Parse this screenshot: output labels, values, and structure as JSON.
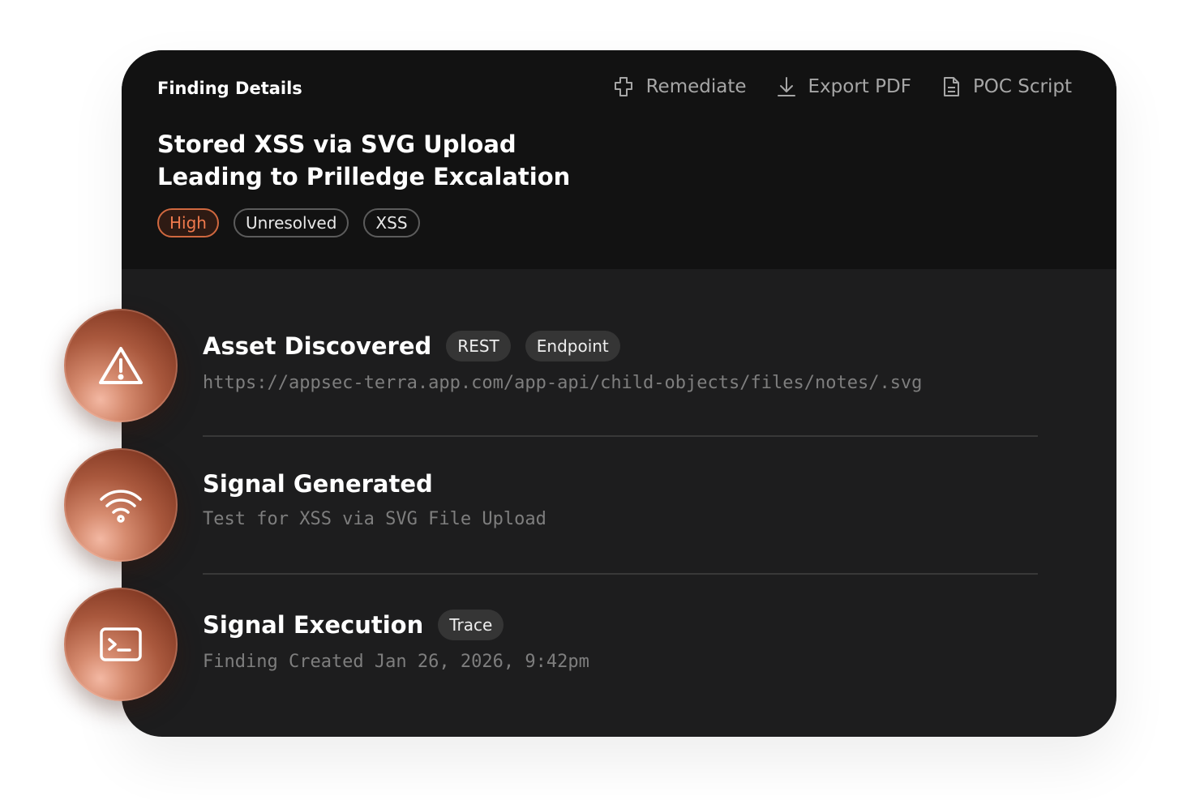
{
  "header": {
    "label": "Finding Details",
    "actions": [
      {
        "label": "Remediate",
        "icon": "puzzle-icon"
      },
      {
        "label": "Export PDF",
        "icon": "download-icon"
      },
      {
        "label": "POC Script",
        "icon": "document-icon"
      }
    ],
    "title_lines": [
      "Stored XSS via SVG Upload",
      "Leading to Prilledge Excalation"
    ],
    "chips": [
      "High",
      "Unresolved",
      "XSS"
    ]
  },
  "steps": [
    {
      "title": "Asset Discovered",
      "tags": [
        "REST",
        "Endpoint"
      ],
      "detail": "https://appsec-terra.app.com/app-api/child-objects/files/notes/.svg",
      "icon": "warning-icon"
    },
    {
      "title": "Signal Generated",
      "tags": [],
      "detail": "Test for XSS via SVG File Upload",
      "icon": "wifi-icon"
    },
    {
      "title": "Signal Execution",
      "tags": [
        "Trace"
      ],
      "detail": "Finding Created Jan 26, 2026, 9:42pm",
      "icon": "terminal-icon"
    }
  ],
  "colors": {
    "card": "#1d1d1e",
    "header": "#121212",
    "severity": "#f07a4d",
    "orb": "#a9583d"
  }
}
